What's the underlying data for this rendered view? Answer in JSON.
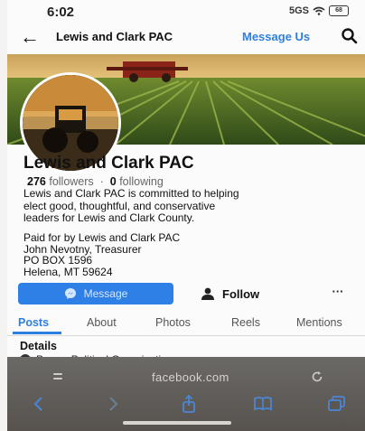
{
  "status_bar": {
    "time": "6:02",
    "signal": "5GS",
    "battery": "68"
  },
  "nav": {
    "title": "Lewis and Clark PAC",
    "message_link": "Message Us"
  },
  "profile": {
    "name": "Lewis and Clark PAC",
    "followers_count": "276",
    "followers_label": "followers",
    "separator": "·",
    "following_count": "0",
    "following_label": "following",
    "bio_lines": [
      "Lewis and Clark PAC is committed to helping",
      "elect good, thoughtful, and conservative",
      "leaders for Lewis and Clark County."
    ],
    "disclaimer_lines": [
      "Paid for by Lewis and Clark PAC",
      "John Nevotny, Treasurer",
      "PO BOX 1596",
      "Helena, MT 59624"
    ]
  },
  "actions": {
    "message": "Message",
    "follow": "Follow",
    "more": "···"
  },
  "tabs": [
    "Posts",
    "About",
    "Photos",
    "Reels",
    "Mentions"
  ],
  "details": {
    "heading": "Details",
    "row_text": "Page · Political Organization"
  },
  "browser": {
    "url": "facebook.com"
  },
  "colors": {
    "accent": "#2d7fe0",
    "button": "#2e80e6",
    "browser_bar": "#605c58"
  }
}
